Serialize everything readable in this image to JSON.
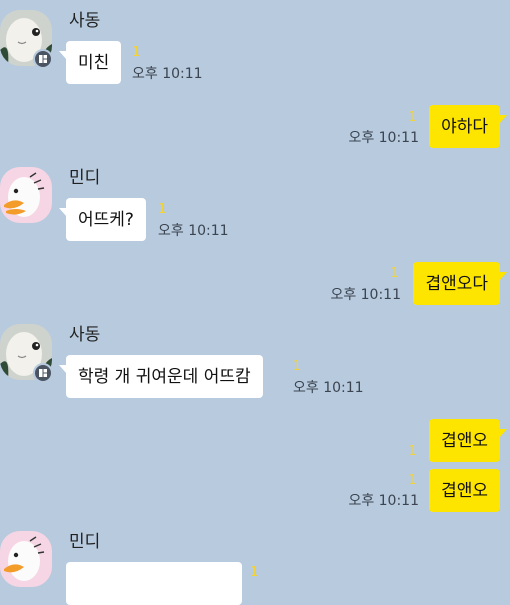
{
  "colors": {
    "background": "#b7cade",
    "incoming_bubble": "#ffffff",
    "outgoing_bubble": "#fee500",
    "unread_count": "#f2d33a"
  },
  "messages": [
    {
      "direction": "in",
      "sender": "사동",
      "avatar_icon": "pale-creature-avatar-icon",
      "text": "미친",
      "unread": "1",
      "time": "오후 10:11"
    },
    {
      "direction": "out",
      "text": "야하다",
      "unread": "1",
      "time": "오후 10:11"
    },
    {
      "direction": "in",
      "sender": "민디",
      "avatar_icon": "duck-avatar-icon",
      "text": "어뜨케?",
      "unread": "1",
      "time": "오후 10:11"
    },
    {
      "direction": "out",
      "text": "겹앤오다",
      "unread": "1",
      "time": "오후 10:11"
    },
    {
      "direction": "in",
      "sender": "사동",
      "avatar_icon": "pale-creature-avatar-icon",
      "text": "학령 개 귀여운데 어뜨캄",
      "unread": "1",
      "time": "오후 10:11"
    },
    {
      "direction": "out",
      "text": "겹앤오",
      "unread": "1",
      "time": ""
    },
    {
      "direction": "out",
      "text": "겹앤오",
      "unread": "1",
      "time": "오후 10:11"
    },
    {
      "direction": "in",
      "sender": "민디",
      "avatar_icon": "duck-avatar-icon",
      "text": "",
      "unread": "1",
      "time": ""
    }
  ]
}
